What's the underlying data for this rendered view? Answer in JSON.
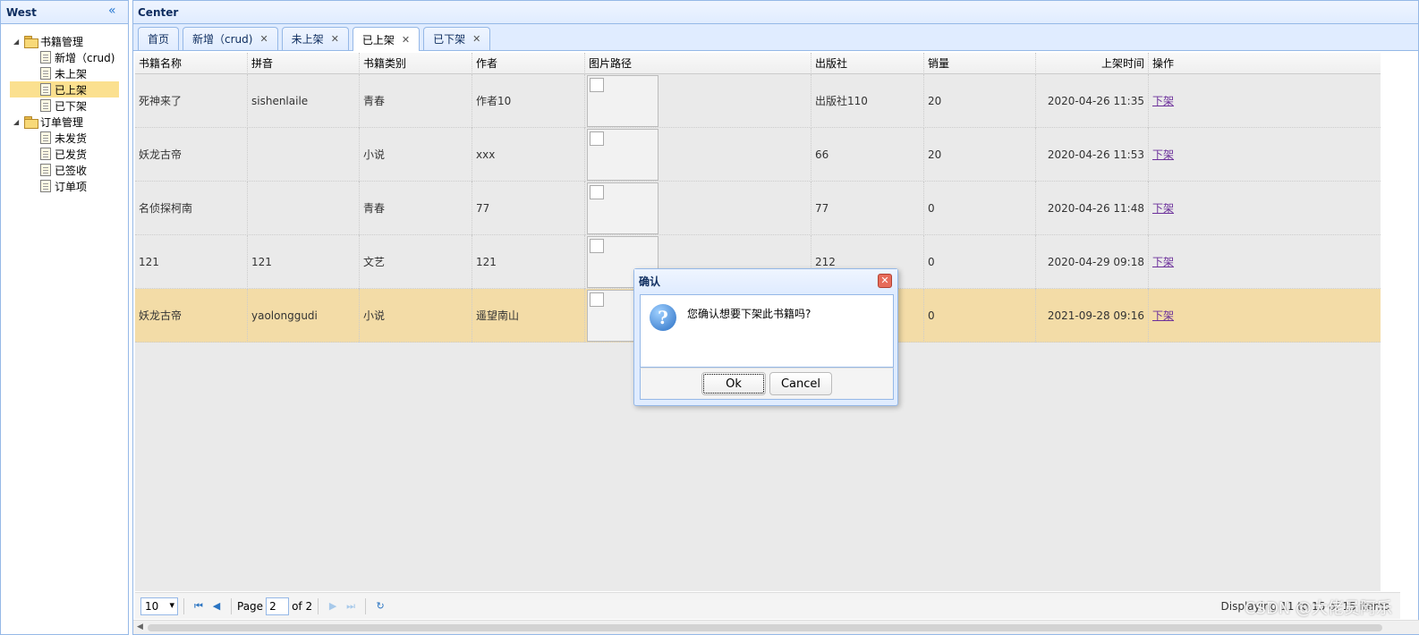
{
  "west": {
    "title": "West",
    "tree": [
      {
        "label": "书籍管理",
        "children": [
          "新增（crud)",
          "未上架",
          "已上架",
          "已下架"
        ]
      },
      {
        "label": "订单管理",
        "children": [
          "未发货",
          "已发货",
          "已签收",
          "订单项"
        ]
      }
    ],
    "selected": "已上架"
  },
  "center": {
    "title": "Center",
    "tabs": [
      {
        "label": "首页",
        "closable": false
      },
      {
        "label": "新增（crud)",
        "closable": true
      },
      {
        "label": "未上架",
        "closable": true
      },
      {
        "label": "已上架",
        "closable": true,
        "active": true
      },
      {
        "label": "已下架",
        "closable": true
      }
    ]
  },
  "grid": {
    "columns": [
      "书籍名称",
      "拼音",
      "书籍类别",
      "作者",
      "图片路径",
      "出版社",
      "销量",
      "上架时间",
      "操作"
    ],
    "rows": [
      {
        "name": "死神来了",
        "pinyin": "sishenlaile",
        "category": "青春",
        "author": "作者10",
        "publisher": "出版社110",
        "sales": "20",
        "time": "2020-04-26 11:35",
        "action": "下架"
      },
      {
        "name": "妖龙古帝",
        "pinyin": "",
        "category": "小说",
        "author": "xxx",
        "publisher": "66",
        "sales": "20",
        "time": "2020-04-26 11:53",
        "action": "下架"
      },
      {
        "name": "名侦探柯南",
        "pinyin": "",
        "category": "青春",
        "author": "77",
        "publisher": "77",
        "sales": "0",
        "time": "2020-04-26 11:48",
        "action": "下架"
      },
      {
        "name": "121",
        "pinyin": "121",
        "category": "文艺",
        "author": "121",
        "publisher": "212",
        "sales": "0",
        "time": "2020-04-29 09:18",
        "action": "下架"
      },
      {
        "name": "妖龙古帝",
        "pinyin": "yaolonggudi",
        "category": "小说",
        "author": "遥望南山",
        "publisher": "",
        "sales": "0",
        "time": "2021-09-28 09:16",
        "action": "下架",
        "selected": true
      }
    ]
  },
  "pager": {
    "page_size": "10",
    "page_label": "Page",
    "page_value": "2",
    "of_label": "of 2",
    "info": "Displaying 11 to 15 of 15 items"
  },
  "dialog": {
    "title": "确认",
    "message": "您确认想要下架此书籍吗?",
    "ok": "Ok",
    "cancel": "Cancel",
    "icon": "question-icon"
  },
  "watermark": "CSDN @大佬员阿乐"
}
